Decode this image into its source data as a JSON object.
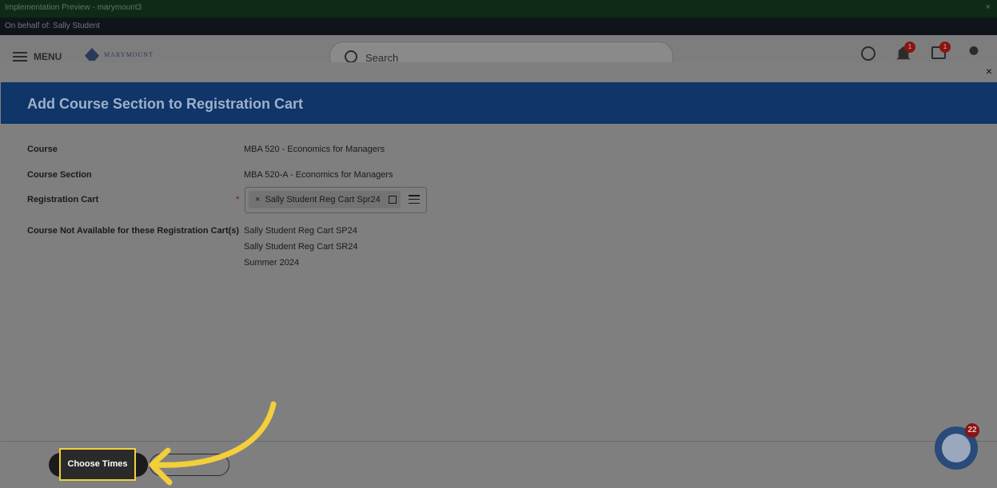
{
  "window": {
    "title": "Implementation Preview - marymount3",
    "close": "×",
    "on_behalf": "On behalf of: Sally Student"
  },
  "appbar": {
    "menu_label": "MENU",
    "logo_text": "MARYMOUNT",
    "search_placeholder": "Search",
    "notification_count": "1",
    "inbox_count": "1"
  },
  "modal": {
    "close": "×",
    "title": "Add Course Section to Registration Cart",
    "fields": {
      "course_label": "Course",
      "course_value": "MBA 520 - Economics for Managers",
      "section_label": "Course Section",
      "section_value": "MBA 520-A - Economics for Managers",
      "cart_label": "Registration Cart",
      "cart_required": "*",
      "cart_selected": "Sally Student Reg Cart Spr24",
      "cart_remove": "×",
      "not_available_label": "Course Not Available for these Registration Cart(s)",
      "not_available": [
        "Sally Student Reg Cart SP24",
        "Sally Student Reg Cart SR24",
        "Summer 2024"
      ]
    },
    "buttons": {
      "choose_times": "Choose Times"
    }
  },
  "help": {
    "badge": "22"
  },
  "colors": {
    "highlight": "#f2cf3b",
    "header": "#0f3569"
  }
}
